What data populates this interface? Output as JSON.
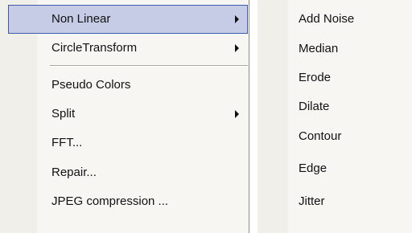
{
  "parent_menu": {
    "items": [
      {
        "label": "Non Linear",
        "has_submenu": true,
        "highlighted": true
      },
      {
        "label": "CircleTransform",
        "has_submenu": true
      },
      {
        "label": "Pseudo Colors"
      },
      {
        "label": "Split",
        "has_submenu": true
      },
      {
        "label": "FFT..."
      },
      {
        "label": "Repair..."
      },
      {
        "label": "JPEG compression ..."
      }
    ],
    "highlight_color": "#c7cce6",
    "highlight_border_color": "#3e5aa8"
  },
  "submenu": {
    "items": [
      {
        "label": "Add Noise"
      },
      {
        "label": "Median"
      },
      {
        "label": "Erode"
      },
      {
        "label": "Dilate"
      },
      {
        "label": "Contour"
      },
      {
        "label": "Edge"
      },
      {
        "label": "Jitter"
      }
    ]
  },
  "icons": {
    "submenu_arrow": "chevron-right-icon"
  }
}
